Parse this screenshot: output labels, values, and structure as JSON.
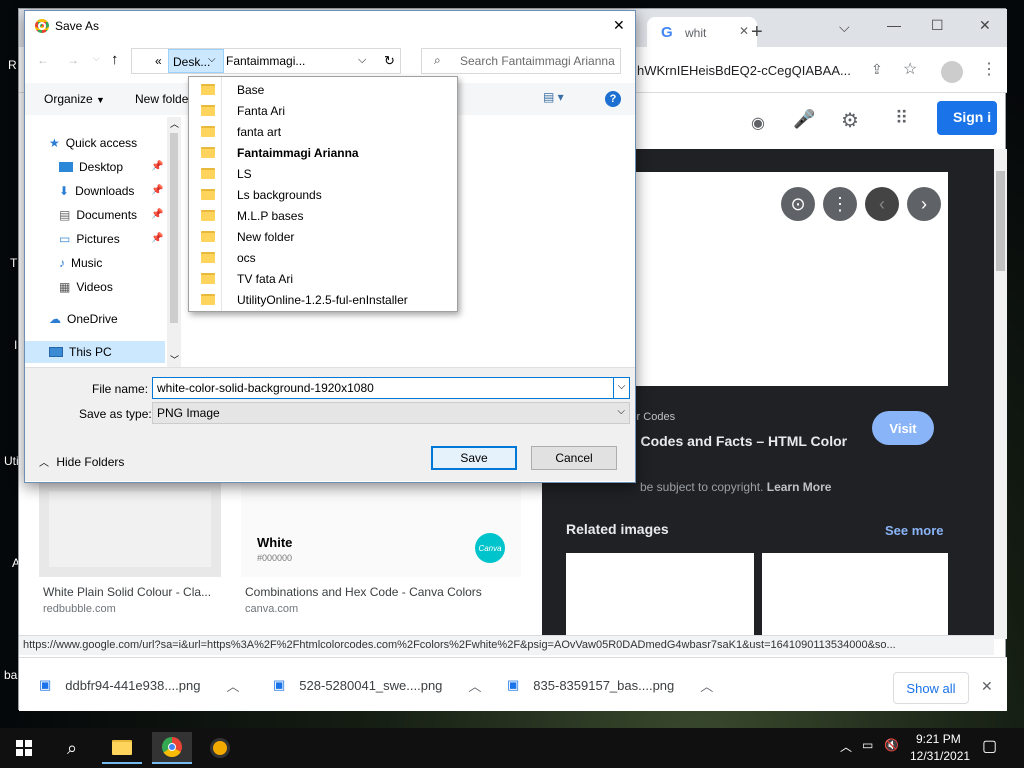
{
  "desktop": {
    "labels": [
      "R",
      "T",
      "I",
      "Uti",
      "A",
      "ba"
    ]
  },
  "chrome": {
    "tab_title": "whit",
    "new_tab_symbol": "+",
    "url": "hWKrnIEHeisBdEQ2-cCegQIABAA...",
    "sign_in": "Sign i",
    "preview_source": "lor Codes",
    "preview_title": "r, Codes and Facts – HTML Color",
    "visit": "Visit",
    "copyright_prefix": "be subject to copyright.",
    "learn_more": "Learn More",
    "related_images": "Related images",
    "see_more": "See more",
    "results": [
      {
        "title": "White Plain Solid Colour - Cla...",
        "source": "redbubble.com"
      },
      {
        "title": "Combinations and Hex Code - Canva Colors",
        "source": "canva.com"
      }
    ],
    "canva_card_title": "White",
    "canva_card_hex": "#000000",
    "canva_logo": "Canva",
    "status_url": "https://www.google.com/url?sa=i&url=https%3A%2F%2Fhtmlcolorcodes.com%2Fcolors%2Fwhite%2F&psig=AOvVaw05R0DADmedG4wbasr7saK1&ust=1641090113534000&so...",
    "downloads": [
      {
        "name": "ddbfr94-441e938....png"
      },
      {
        "name": "528-5280041_swe....png"
      },
      {
        "name": "835-8359157_bas....png"
      }
    ],
    "show_all": "Show all"
  },
  "dialog": {
    "title": "Save As",
    "breadcrumb_prefix": "«",
    "breadcrumb_current": "Desk...",
    "breadcrumb_folder": "Fantaimmagi...",
    "search_placeholder": "Search Fantaimmagi Arianna",
    "organize": "Organize",
    "new_folder": "New folde",
    "nav": [
      {
        "label": "Quick access",
        "icon": "star-icon",
        "pinned": false
      },
      {
        "label": "Desktop",
        "icon": "desktop-icon",
        "pinned": true
      },
      {
        "label": "Downloads",
        "icon": "download-icon",
        "pinned": true
      },
      {
        "label": "Documents",
        "icon": "documents-icon",
        "pinned": true
      },
      {
        "label": "Pictures",
        "icon": "pictures-icon",
        "pinned": true
      },
      {
        "label": "Music",
        "icon": "music-icon",
        "pinned": false
      },
      {
        "label": "Videos",
        "icon": "videos-icon",
        "pinned": false
      },
      {
        "label": "OneDrive",
        "icon": "cloud-icon",
        "pinned": false
      },
      {
        "label": "This PC",
        "icon": "pc-icon",
        "pinned": false
      }
    ],
    "dropdown_items": [
      {
        "label": "Base",
        "bold": false
      },
      {
        "label": "Fanta Ari",
        "bold": false
      },
      {
        "label": "fanta art",
        "bold": false
      },
      {
        "label": "Fantaimmagi Arianna",
        "bold": true
      },
      {
        "label": "LS",
        "bold": false
      },
      {
        "label": "Ls backgrounds",
        "bold": false
      },
      {
        "label": "M.L.P bases",
        "bold": false
      },
      {
        "label": "New folder",
        "bold": false
      },
      {
        "label": "ocs",
        "bold": false
      },
      {
        "label": "TV  fata Ari",
        "bold": false
      },
      {
        "label": "UtilityOnline-1.2.5-ful-enInstaller",
        "bold": false
      }
    ],
    "file_name_label": "File name:",
    "file_name_value": "white-color-solid-background-1920x1080",
    "save_as_type_label": "Save as type:",
    "save_as_type_value": "PNG Image",
    "hide_folders": "Hide Folders",
    "save": "Save",
    "cancel": "Cancel"
  },
  "taskbar": {
    "time": "9:21 PM",
    "date": "12/31/2021"
  },
  "colors": {
    "accent": "#1a73e8",
    "visit": "#8ab4f8",
    "dialog_border": "#6d8fb3",
    "canva": "#00c4cc"
  }
}
